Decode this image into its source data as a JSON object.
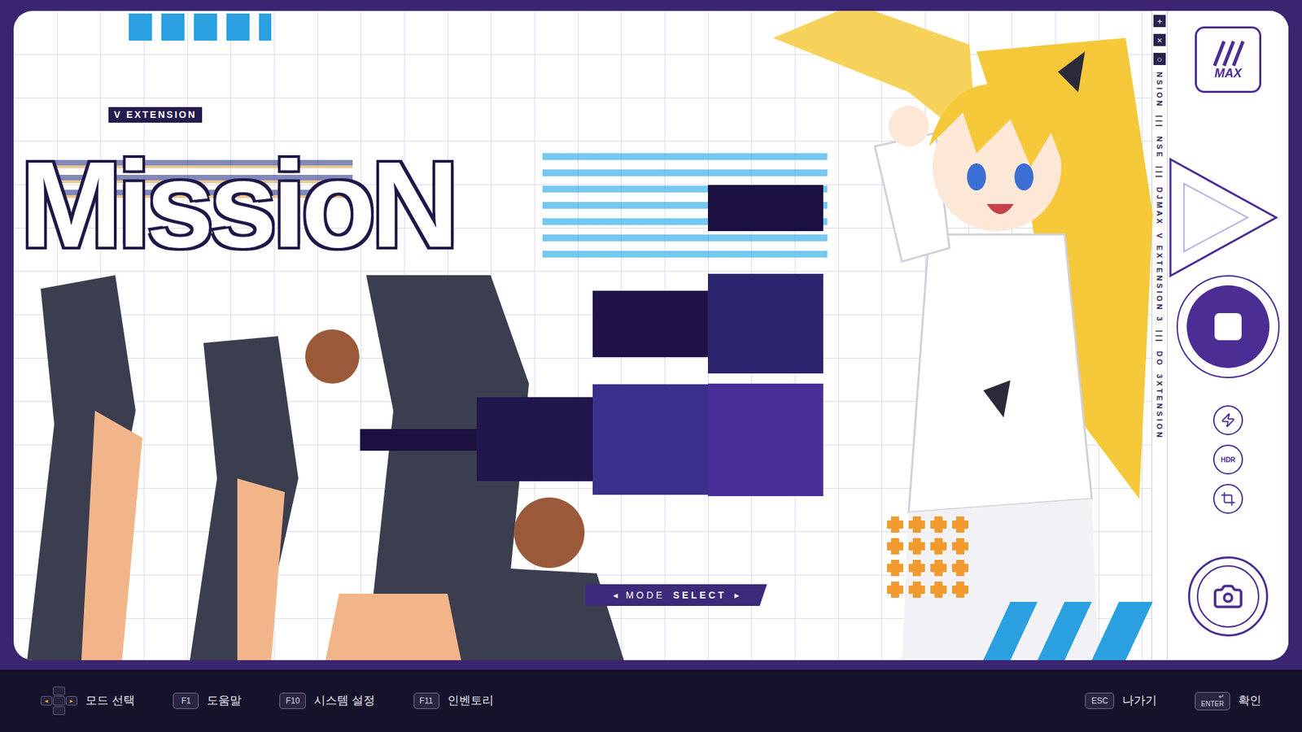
{
  "header": {
    "edition_label": "V EXTENSION",
    "mode_title": "MissioN"
  },
  "mode_selector": {
    "prev": "◂",
    "label_light": "MODE",
    "label_bold": "SELECT",
    "next": "▸"
  },
  "side_strip": {
    "symbols": [
      "+",
      "×",
      "○"
    ],
    "segments": [
      "NSION",
      "|||",
      "NSE",
      "|||",
      "DJMAX",
      "V EXTENSION 3",
      "|||",
      "DO",
      "3XTENSION"
    ]
  },
  "logo": {
    "text": "MAX"
  },
  "side_buttons": [
    {
      "kind": "record"
    },
    {
      "kind": "boost"
    },
    {
      "kind": "hdr",
      "label": "HDR"
    },
    {
      "kind": "crop"
    },
    {
      "kind": "camera"
    }
  ],
  "footer": {
    "left": [
      {
        "kind": "dpad",
        "glyphs": [
          "◂",
          "▸"
        ],
        "label": "모드 선택"
      },
      {
        "kind": "key",
        "key": "F1",
        "label": "도움말"
      },
      {
        "kind": "key",
        "key": "F10",
        "label": "시스템 설정"
      },
      {
        "kind": "key",
        "key": "F11",
        "label": "인벤토리"
      }
    ],
    "right": [
      {
        "kind": "key",
        "key": "ESC",
        "label": "나가기"
      },
      {
        "kind": "enter",
        "key": "ENTER",
        "glyph": "↵",
        "label": "확인"
      }
    ]
  }
}
